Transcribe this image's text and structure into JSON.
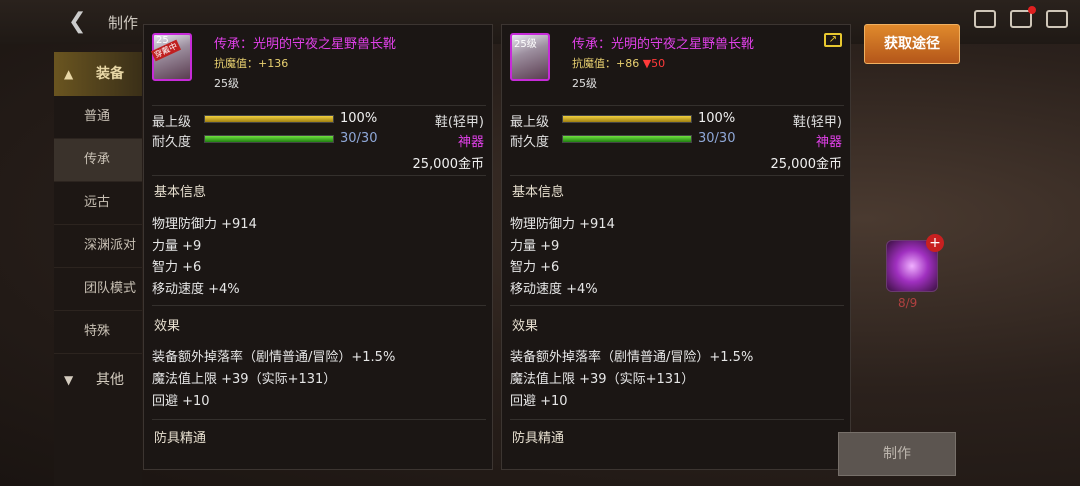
{
  "topbar": {
    "title": "制作"
  },
  "sidebar": {
    "category": "装备",
    "items": [
      "普通",
      "传承",
      "远古",
      "深渊派对",
      "团队模式",
      "特殊"
    ],
    "other": "其他"
  },
  "panels": [
    {
      "icon_level": "25",
      "icon_badge": "穿戴中",
      "name": "传承：光明的守夜之星野兽长靴",
      "magic_res_label": "抗魔值：",
      "magic_res_value": "+136",
      "magic_res_diff": "",
      "level": "25级",
      "grade_label": "最上级",
      "grade_value": "100%",
      "grade_fraction": 1.0,
      "durability_label": "耐久度",
      "durability_value": "30/30",
      "durability_fraction": 1.0,
      "type": "鞋(轻甲)",
      "rarity": "神器",
      "price": "25,000金币",
      "basic_title": "基本信息",
      "basic": [
        "物理防御力 +914",
        "力量 +9",
        "智力 +6",
        "移动速度 +4%"
      ],
      "effect_title": "效果",
      "effects": [
        "装备额外掉落率（剧情普通/冒险）+1.5%",
        "魔法值上限 +39（实际+131）",
        "回避 +10"
      ],
      "mastery_title": "防具精通"
    },
    {
      "icon_level": "25级",
      "icon_badge": "",
      "name": "传承：光明的守夜之星野兽长靴",
      "magic_res_label": "抗魔值：",
      "magic_res_value": "+86",
      "magic_res_diff": "▼50",
      "level": "25级",
      "grade_label": "最上级",
      "grade_value": "100%",
      "grade_fraction": 1.0,
      "durability_label": "耐久度",
      "durability_value": "30/30",
      "durability_fraction": 1.0,
      "type": "鞋(轻甲)",
      "rarity": "神器",
      "price": "25,000金币",
      "basic_title": "基本信息",
      "basic": [
        "物理防御力 +914",
        "力量 +9",
        "智力 +6",
        "移动速度 +4%"
      ],
      "effect_title": "效果",
      "effects": [
        "装备额外掉落率（剧情普通/冒险）+1.5%",
        "魔法值上限 +39（实际+131）",
        "回避 +10"
      ],
      "mastery_title": "防具精通"
    }
  ],
  "acquire_button": "获取途径",
  "material_count": "8/9",
  "make_button": "制作",
  "icons": [
    "back-arrow-icon",
    "share-icon",
    "mail-icon",
    "chat-icon",
    "plus-icon"
  ],
  "colors": {
    "epic": "#e040e8",
    "gold": "#e8d070",
    "down": "#ff3a3a",
    "acquire": "#d07020"
  }
}
